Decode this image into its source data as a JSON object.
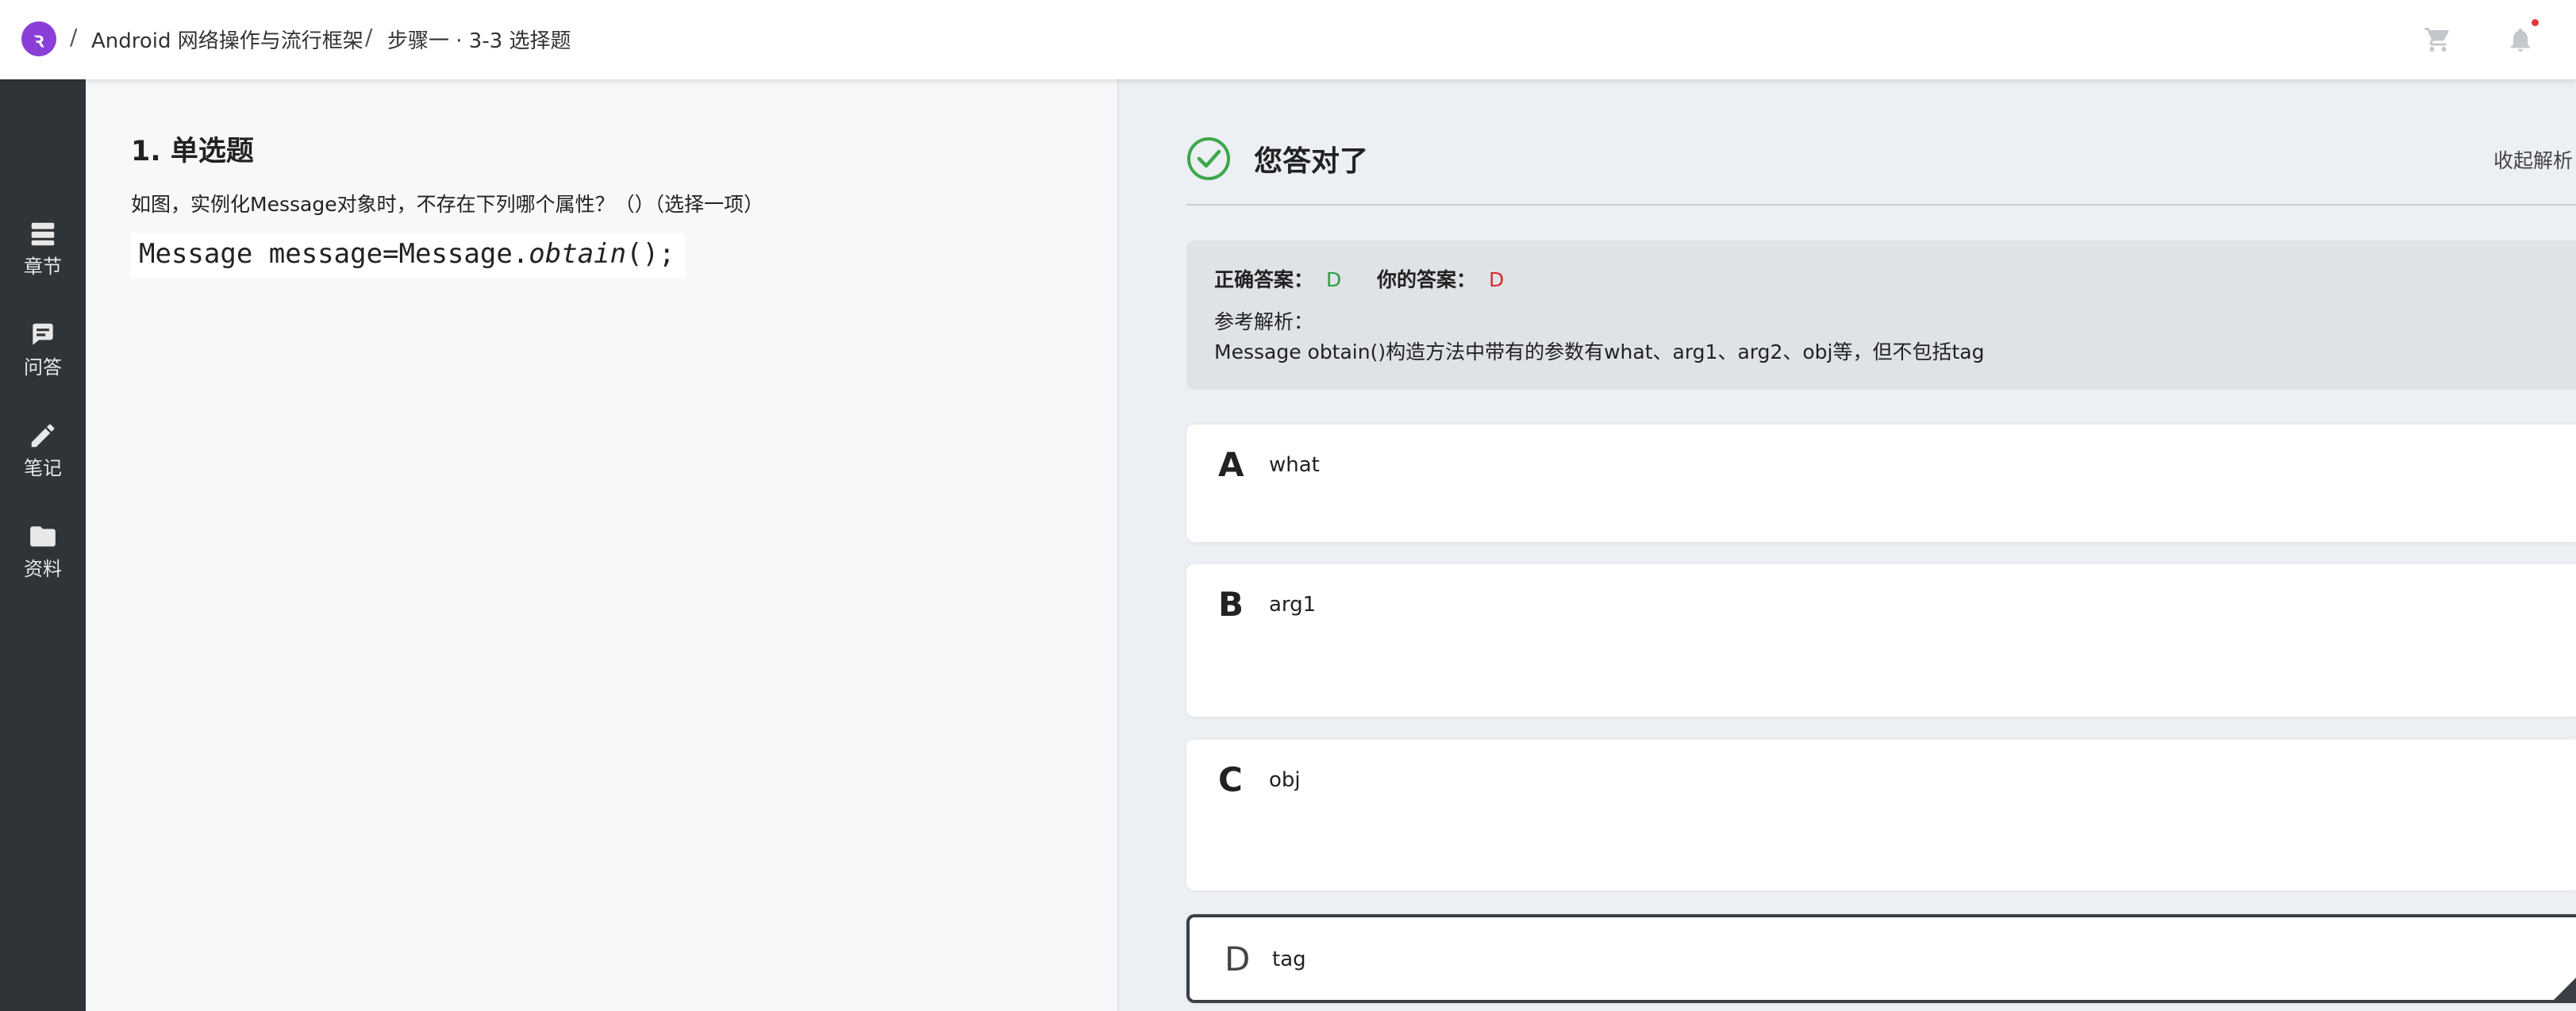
{
  "header": {
    "logo_glyph": "ꝛ",
    "breadcrumb": [
      {
        "label": "Android 网络操作与流行框架"
      },
      {
        "label": "步骤一 · 3-3 选择题"
      }
    ],
    "separator": "/",
    "cart_icon": "cart-icon",
    "bell_icon": "bell-icon",
    "notification_dot_color": "#e53935"
  },
  "sidebar": {
    "items": [
      {
        "label": "章节",
        "icon": "chapters-icon"
      },
      {
        "label": "问答",
        "icon": "qa-icon"
      },
      {
        "label": "笔记",
        "icon": "notes-icon"
      },
      {
        "label": "资料",
        "icon": "folder-icon"
      }
    ]
  },
  "question": {
    "title": "1. 单选题",
    "text": "如图，实例化Message对象时，不存在下列哪个属性？（）（选择一项）",
    "code_prefix": "Message message=Message.",
    "code_method": "obtain",
    "code_suffix": "();"
  },
  "result": {
    "status_text": "您答对了",
    "collapse_label": "收起解析",
    "status_color": "#3aa84a"
  },
  "analysis": {
    "correct_label": "正确答案：",
    "correct_value": "D",
    "your_label": "你的答案：",
    "your_value": "D",
    "ref_label": "参考解析：",
    "ref_text": "Message obtain()构造方法中带有的参数有what、arg1、arg2、obj等，但不包括tag"
  },
  "options": [
    {
      "letter": "A",
      "text": "what"
    },
    {
      "letter": "B",
      "text": "arg1"
    },
    {
      "letter": "C",
      "text": "obj"
    },
    {
      "letter": "D",
      "text": "tag",
      "selected": true
    }
  ]
}
